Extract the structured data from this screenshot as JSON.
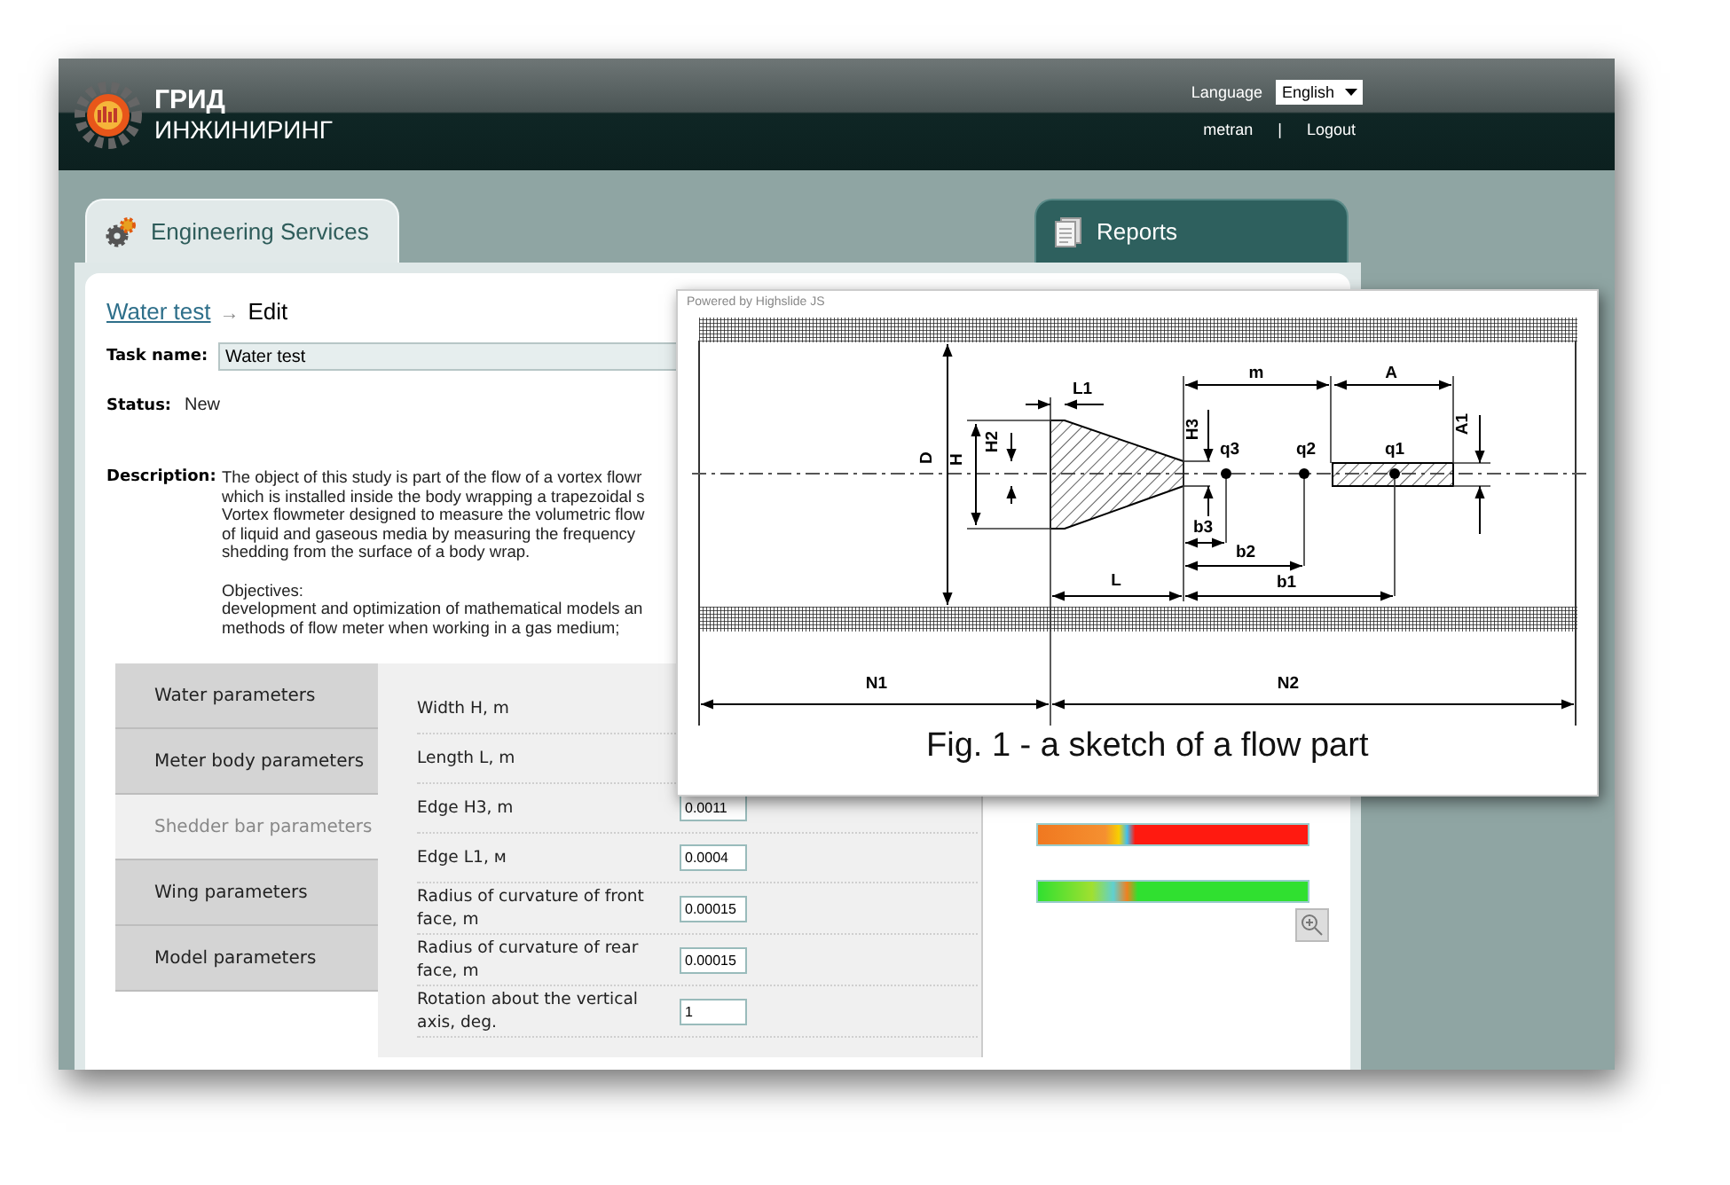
{
  "header": {
    "logo_line_1": "ГРИД",
    "logo_line_2": "ИНЖИНИРИНГ",
    "language_label": "Language",
    "language_value": "English",
    "user": "metran",
    "separator": "|",
    "logout": "Logout"
  },
  "tabs": [
    {
      "label": "Engineering Services",
      "selected": true,
      "kind": "services"
    },
    {
      "label": "Reports",
      "selected": false,
      "kind": "reports"
    }
  ],
  "breadcrumb": {
    "link": "Water test",
    "arrow": "→",
    "current": "Edit"
  },
  "task": {
    "name_label": "Task name:",
    "name_value": "Water test",
    "status_label": "Status:",
    "status_value": "New",
    "description_label": "Description:",
    "description": [
      [
        "The object of this study is part of the flow of a vortex flowr",
        "which is installed inside the body wrapping a trapezoidal s",
        "Vortex flowmeter designed to measure the volumetric flow",
        "of liquid and gaseous media by measuring the frequency",
        "shedding from the surface of a body wrap."
      ],
      [
        "Objectives:",
        "development and optimization of mathematical models an",
        "methods of flow meter when working in a gas medium;"
      ]
    ]
  },
  "sections": [
    {
      "label": "Water parameters",
      "selected": false
    },
    {
      "label": "Meter body parameters",
      "selected": false
    },
    {
      "label": "Shedder bar parameters",
      "selected": true
    },
    {
      "label": "Wing parameters",
      "selected": false
    },
    {
      "label": "Model parameters",
      "selected": false
    }
  ],
  "fields": [
    {
      "label": "Width H, m"
    },
    {
      "label": "Length L, m"
    },
    {
      "label": "Edge H3, m",
      "value": "0.0011"
    },
    {
      "label": "Edge L1, м",
      "value": "0.0004"
    },
    {
      "label": "Radius of curvature of front face, m",
      "value": "0.00015"
    },
    {
      "label": "Radius of curvature of rear face, m",
      "value": "0.00015"
    },
    {
      "label": "Rotation about the vertical axis, deg.",
      "value": "1"
    }
  ],
  "popup": {
    "credit": "Powered by Highslide JS",
    "figure_labels": [
      "D",
      "H",
      "H2",
      "L1",
      "H3",
      "q3",
      "q2",
      "q1",
      "m",
      "A",
      "A1",
      "b3",
      "b2",
      "b1",
      "L",
      "N1",
      "N2"
    ],
    "caption": "Fig. 1  - a sketch of a flow part"
  }
}
